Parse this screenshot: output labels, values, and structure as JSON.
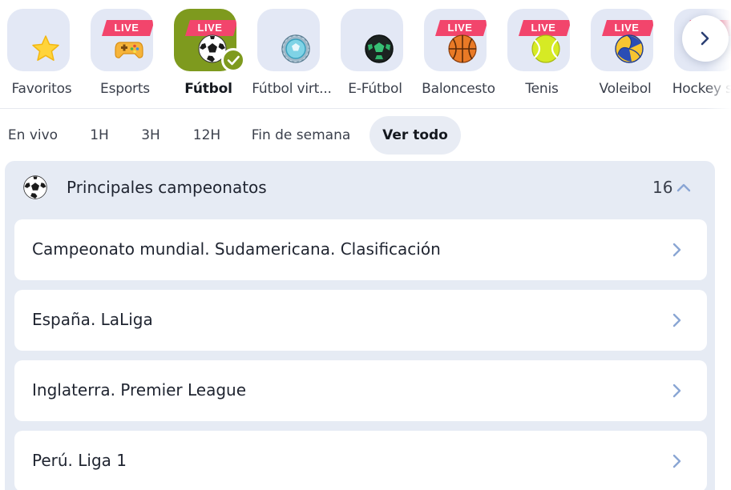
{
  "sports_nav": {
    "live_badge": "LIVE",
    "items": [
      {
        "label": "Favoritos",
        "icon": "star-icon",
        "live": false,
        "active": false
      },
      {
        "label": "Esports",
        "icon": "gamepad-icon",
        "live": true,
        "active": false
      },
      {
        "label": "Fútbol",
        "icon": "soccer-ball-icon",
        "live": true,
        "active": true
      },
      {
        "label": "Fútbol virt...",
        "icon": "virtual-ball-icon",
        "live": false,
        "active": false
      },
      {
        "label": "E-Fútbol",
        "icon": "e-soccer-ball-icon",
        "live": false,
        "active": false
      },
      {
        "label": "Baloncesto",
        "icon": "basketball-icon",
        "live": true,
        "active": false
      },
      {
        "label": "Tenis",
        "icon": "tennis-ball-icon",
        "live": true,
        "active": false
      },
      {
        "label": "Voleibol",
        "icon": "volleyball-icon",
        "live": true,
        "active": false
      },
      {
        "label": "Hockey s...",
        "icon": "hockey-icon",
        "live": true,
        "active": false
      }
    ],
    "next_icon": "chevron-right-icon"
  },
  "time_filters": [
    {
      "label": "En vivo",
      "active": false
    },
    {
      "label": "1H",
      "active": false
    },
    {
      "label": "3H",
      "active": false
    },
    {
      "label": "12H",
      "active": false
    },
    {
      "label": "Fin de semana",
      "active": false
    },
    {
      "label": "Ver todo",
      "active": true
    }
  ],
  "championships": {
    "title": "Principales campeonatos",
    "count": "16",
    "expanded": true,
    "items": [
      {
        "label": "Campeonato mundial. Sudamericana. Clasificación"
      },
      {
        "label": "España. LaLiga"
      },
      {
        "label": "Inglaterra. Premier League"
      },
      {
        "label": "Perú. Liga 1"
      }
    ]
  },
  "colors": {
    "accent_green": "#7e9a1e",
    "live_badge": "#f2456c",
    "tile_bg": "#e3e8f5",
    "panel_bg": "#e6ebf4",
    "chevron": "#8aa6d4"
  }
}
